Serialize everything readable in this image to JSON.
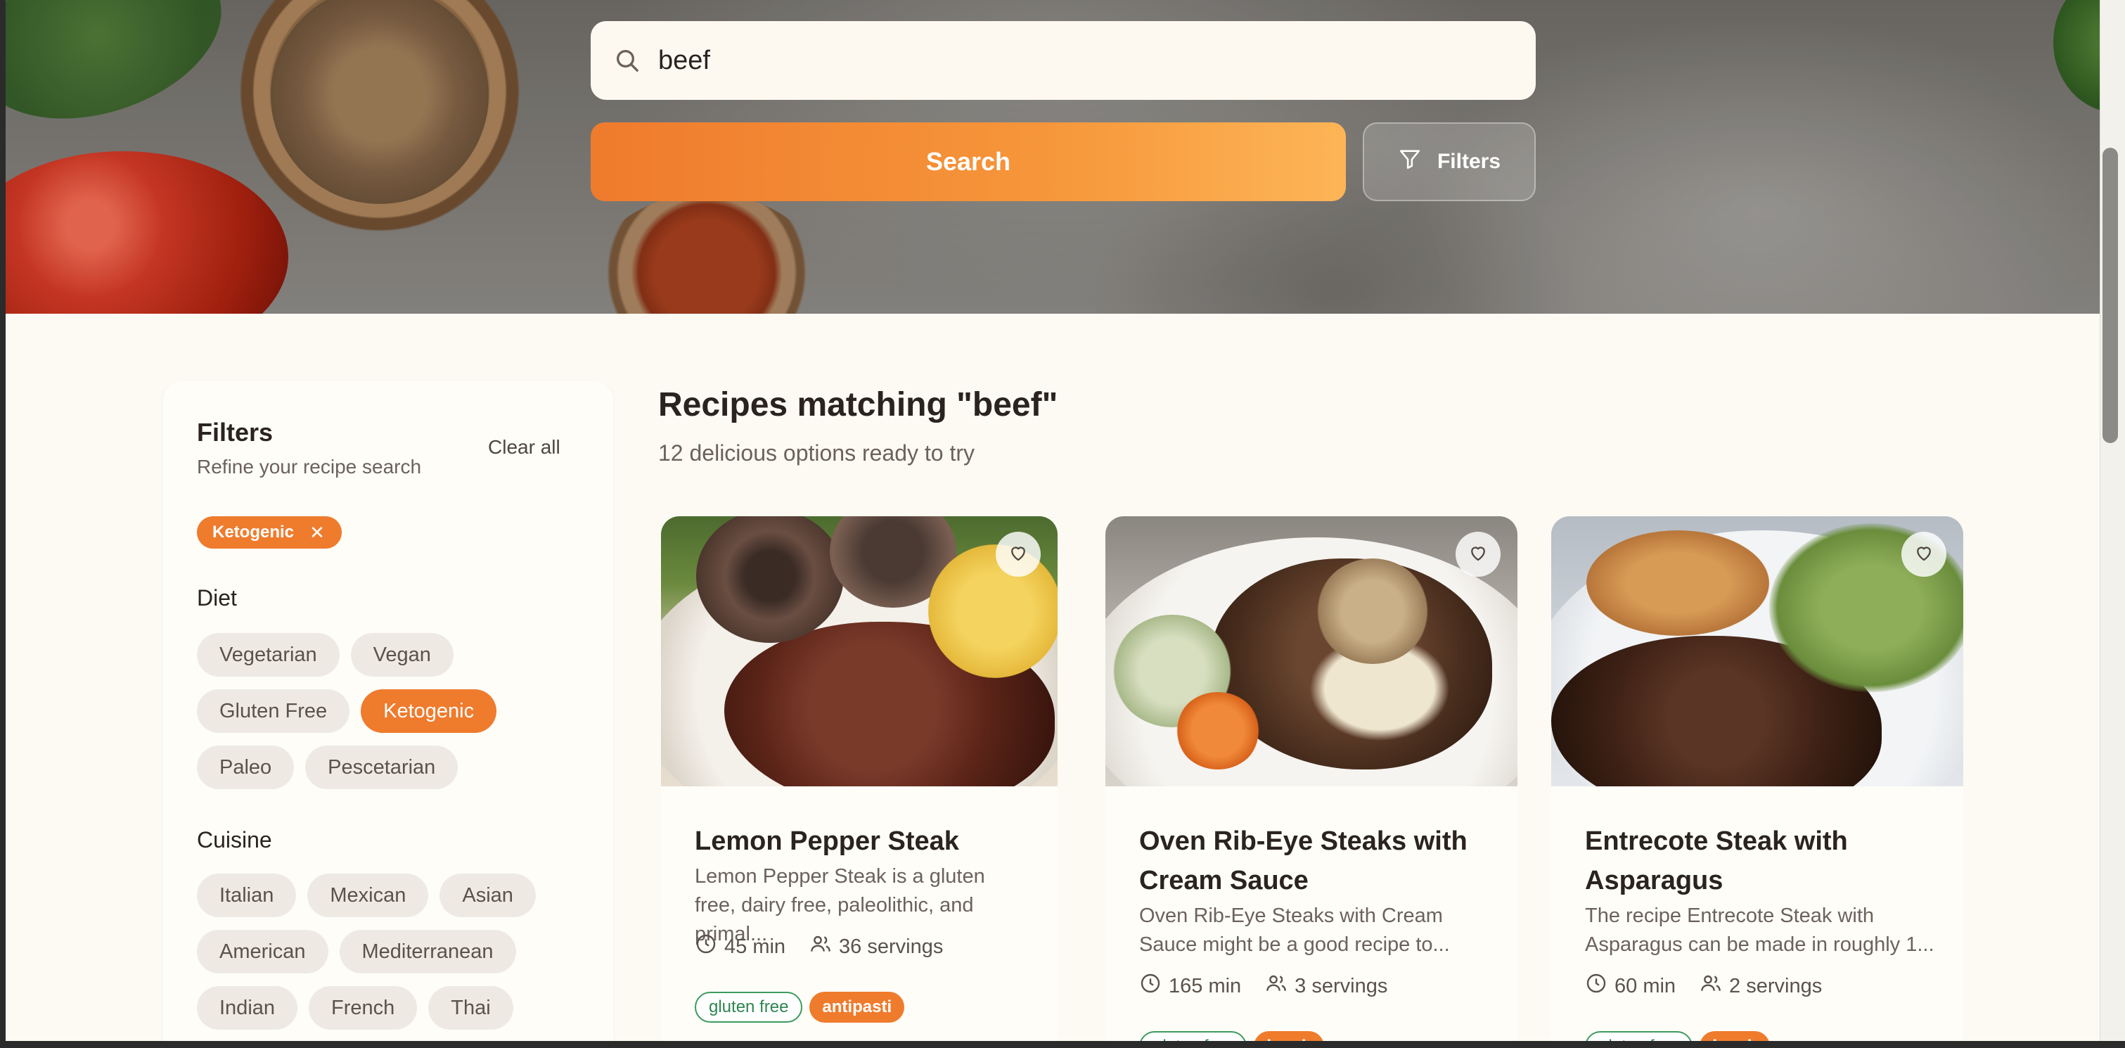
{
  "search": {
    "value": "beef",
    "button_label": "Search",
    "filters_label": "Filters"
  },
  "sidebar": {
    "title": "Filters",
    "subtitle": "Refine your recipe search",
    "clear_label": "Clear all",
    "active_filters": [
      "Ketogenic"
    ],
    "diet": {
      "title": "Diet",
      "options": [
        "Vegetarian",
        "Vegan",
        "Gluten Free",
        "Ketogenic",
        "Paleo",
        "Pescetarian"
      ],
      "selected": "Ketogenic"
    },
    "cuisine": {
      "title": "Cuisine",
      "options": [
        "Italian",
        "Mexican",
        "Asian",
        "American",
        "Mediterranean",
        "Indian",
        "French",
        "Thai"
      ]
    }
  },
  "results": {
    "title": "Recipes matching \"beef\"",
    "subtitle": "12 delicious options ready to try",
    "cards": [
      {
        "title": "Lemon Pepper Steak",
        "description": "Lemon Pepper Steak is a gluten free, dairy free, paleolithic, and primal...",
        "time": "45 min",
        "servings": "36 servings",
        "tags": [
          "gluten free",
          "antipasti"
        ]
      },
      {
        "title": "Oven Rib-Eye Steaks with Cream Sauce",
        "description": "Oven Rib-Eye Steaks with Cream Sauce might be a good recipe to...",
        "time": "165 min",
        "servings": "3 servings",
        "tags": [
          "gluten free",
          "lunch"
        ]
      },
      {
        "title": "Entrecote Steak with Asparagus",
        "description": "The recipe Entrecote Steak with Asparagus can be made in roughly 1...",
        "time": "60 min",
        "servings": "2 servings",
        "tags": [
          "gluten free",
          "lunch"
        ]
      }
    ]
  },
  "icons": {
    "search": "search-icon",
    "filter": "filter-funnel-icon",
    "close": "close-icon",
    "favorite": "heart-icon",
    "time": "clock-icon",
    "servings": "users-icon"
  },
  "colors": {
    "accent": "#ef7b2d",
    "background": "#fdfaf3",
    "tag_green": "#3c9a5f"
  }
}
